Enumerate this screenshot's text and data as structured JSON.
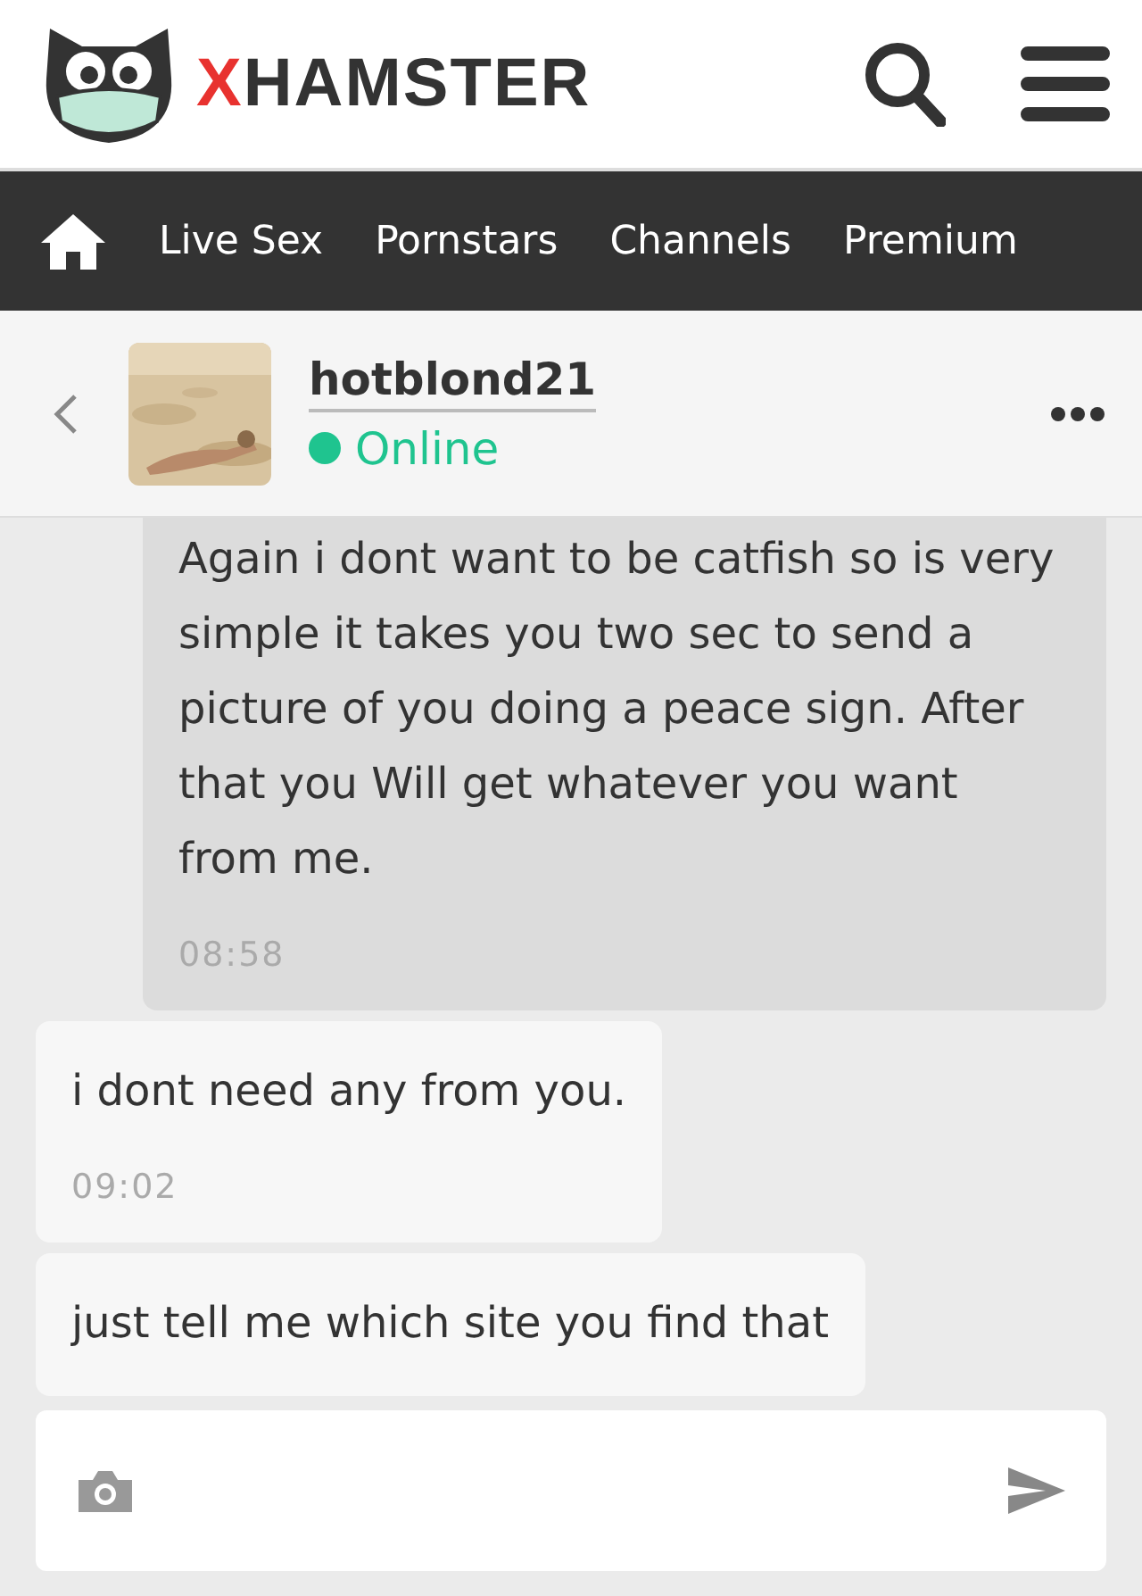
{
  "header": {
    "logo": {
      "accent": "X",
      "rest": "HAMSTER"
    }
  },
  "nav": {
    "items": [
      "Live Sex",
      "Pornstars",
      "Channels",
      "Premium"
    ]
  },
  "chat_header": {
    "username": "hotblond21",
    "status": "Online",
    "online": true
  },
  "messages": [
    {
      "kind": "outgoing",
      "text": "Again i dont want to be catfish so is very simple it takes you two sec to send a picture of you doing a peace sign. After that you Will get whatever you want from me.",
      "time": "08:58"
    },
    {
      "kind": "incoming",
      "text": "i dont need any from you.",
      "time": "09:02"
    },
    {
      "kind": "incoming",
      "text": "just tell me which site you find that"
    }
  ]
}
